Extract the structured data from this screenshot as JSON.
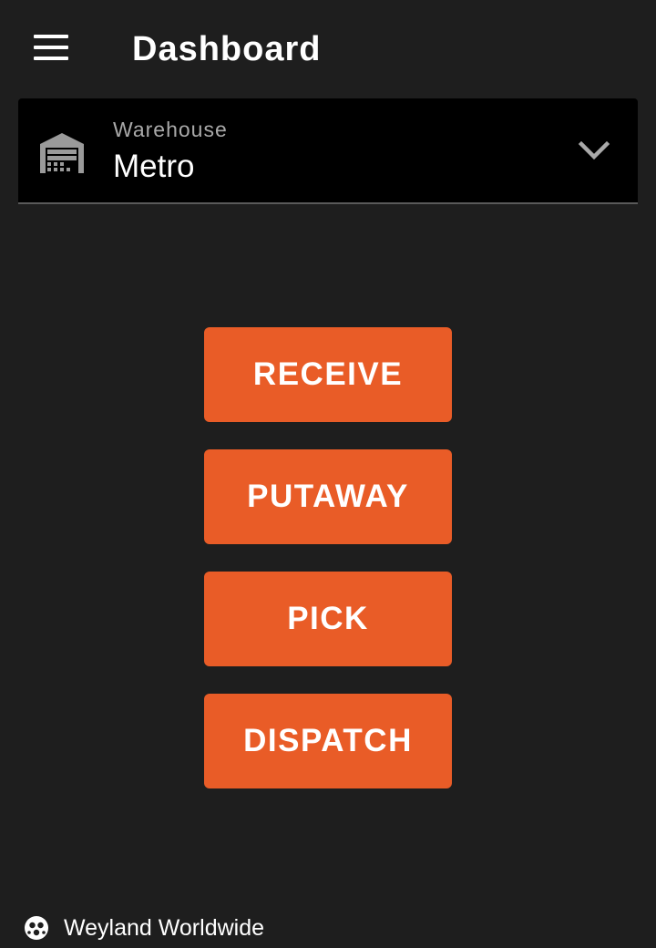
{
  "header": {
    "title": "Dashboard",
    "menu_icon": "hamburger-menu-icon"
  },
  "warehouse_select": {
    "label": "Warehouse",
    "value": "Metro",
    "icon": "warehouse-icon",
    "dropdown_icon": "chevron-down-icon"
  },
  "actions": [
    {
      "label": "RECEIVE"
    },
    {
      "label": "PUTAWAY"
    },
    {
      "label": "PICK"
    },
    {
      "label": "DISPATCH"
    }
  ],
  "footer": {
    "company": "Weyland Worldwide",
    "icon": "company-logo-icon"
  },
  "colors": {
    "background": "#1e1e1e",
    "select_background": "#000000",
    "accent": "#e95c27",
    "label_gray": "#a9a9a9"
  }
}
